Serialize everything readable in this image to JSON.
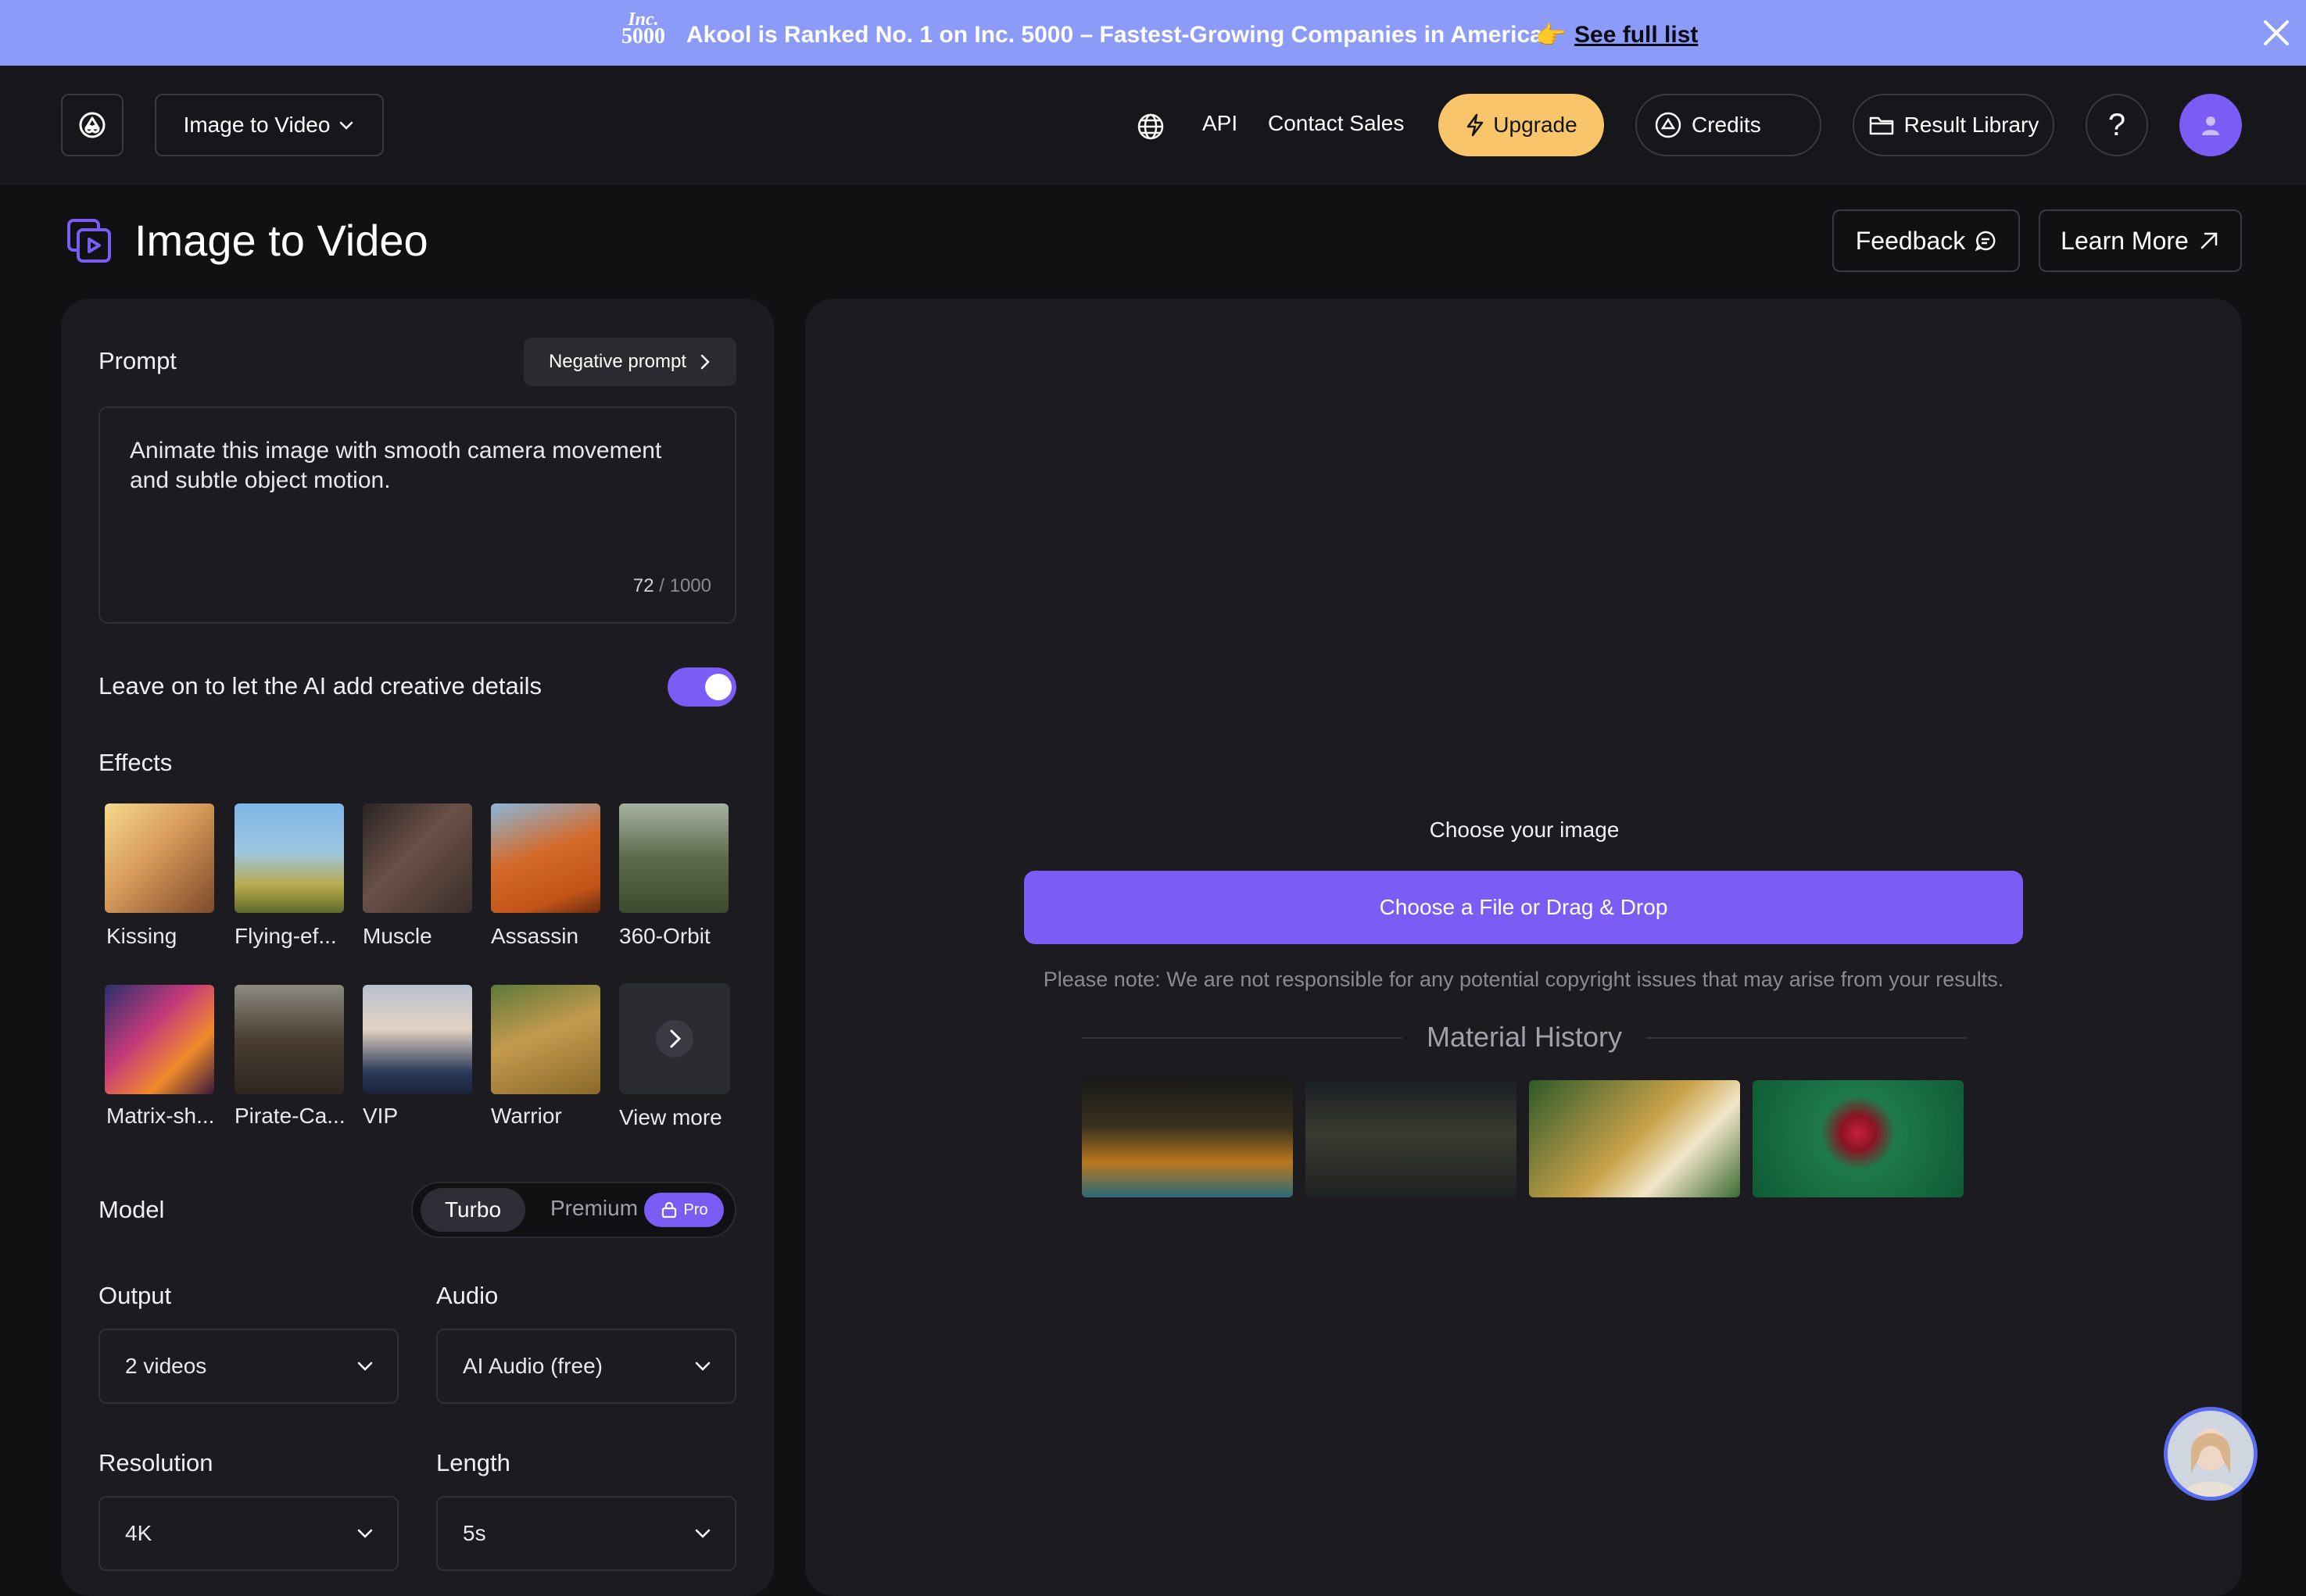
{
  "banner": {
    "inc_logo_line1": "Inc.",
    "inc_logo_line2": "5000",
    "message": "Akool is Ranked No. 1 on Inc. 5000 – Fastest-Growing Companies in America",
    "emoji": "👉",
    "link_label": "See full list",
    "close_icon": "close-icon"
  },
  "header": {
    "mode_label": "Image to Video",
    "nav_api": "API",
    "nav_contact": "Contact Sales",
    "upgrade_label": "Upgrade",
    "credits_label": "Credits",
    "library_label": "Result Library",
    "help_label": "?"
  },
  "page": {
    "title": "Image to Video",
    "feedback_label": "Feedback",
    "learn_more_label": "Learn More"
  },
  "left": {
    "prompt_label": "Prompt",
    "negative_prompt_label": "Negative prompt",
    "prompt_text": "Animate this image with smooth camera movement and subtle object motion.",
    "counter_current": "72",
    "counter_max": "/ 1000",
    "creative_label": "Leave on to let the AI add creative details",
    "creative_enabled": true,
    "effects_label": "Effects",
    "effects": [
      {
        "label": "Kissing"
      },
      {
        "label": "Flying-ef..."
      },
      {
        "label": "Muscle"
      },
      {
        "label": "Assassin"
      },
      {
        "label": "360-Orbit"
      },
      {
        "label": "Matrix-sh..."
      },
      {
        "label": "Pirate-Ca..."
      },
      {
        "label": "VIP"
      },
      {
        "label": "Warrior"
      }
    ],
    "view_more_label": "View more",
    "model_label": "Model",
    "model_turbo": "Turbo",
    "model_premium": "Premium",
    "model_pro_badge": "Pro",
    "output_label": "Output",
    "output_value": "2 videos",
    "audio_label": "Audio",
    "audio_value": "AI Audio (free)",
    "resolution_label": "Resolution",
    "resolution_value": "4K",
    "length_label": "Length",
    "length_value": "5s"
  },
  "right": {
    "choose_title": "Choose your image",
    "choose_button": "Choose a File or Drag & Drop",
    "note": "Please note: We are not responsible for any potential copyright issues that may arise from your results.",
    "history_title": "Material History"
  },
  "colors": {
    "accent": "#7b5cf5",
    "upgrade": "#f8c56a",
    "banner": "#8b9bf7",
    "background": "#111114",
    "panel": "#1b1b20"
  }
}
